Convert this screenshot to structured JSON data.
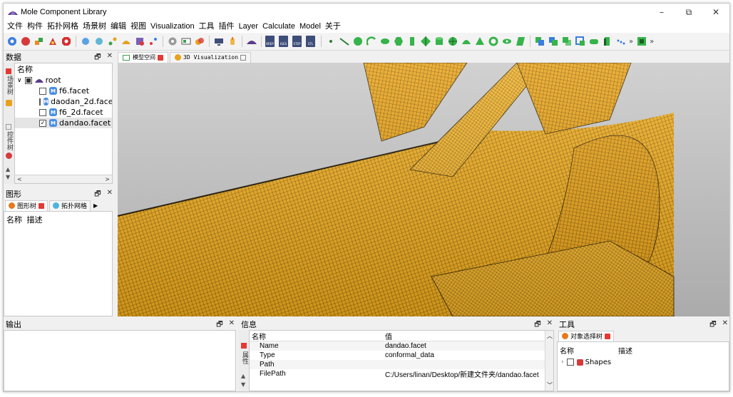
{
  "window": {
    "title": "Mole Component Library",
    "controls": {
      "minimize": "–",
      "restore": "⧉",
      "close": "✕"
    }
  },
  "menu": [
    "文件",
    "构件",
    "拓扑网格",
    "场景树",
    "编辑",
    "视图",
    "Visualization",
    "工具",
    "插件",
    "Layer",
    "Calculate",
    "Model",
    "关于"
  ],
  "toolbar": {
    "file_buttons": [
      "BREP",
      "IGES",
      "STEP",
      "STL"
    ],
    "more": "»"
  },
  "data_panel": {
    "title": "数据",
    "vtabs": [
      "场景树",
      "控件树"
    ],
    "tree_header": "名称",
    "root": "root",
    "items": [
      {
        "label": "f6.facet",
        "checked": false
      },
      {
        "label": "daodan_2d.facet",
        "checked": false
      },
      {
        "label": "f6_2d.facet",
        "checked": false
      },
      {
        "label": "dandao.facet",
        "checked": true
      }
    ],
    "scroll_left": "<",
    "scroll_right": ">"
  },
  "shape_panel": {
    "title": "图形",
    "tabs": [
      "图形树",
      "拓扑网格"
    ],
    "columns": [
      "名称",
      "描述"
    ]
  },
  "viewport": {
    "tabs": [
      "模型空间",
      "3D Visualization"
    ],
    "mesh_color": "#f0ac1e",
    "background": "#c9c9c9"
  },
  "output_panel": {
    "title": "输出"
  },
  "info_panel": {
    "title": "信息",
    "vtab": "属性",
    "columns": [
      "名称",
      "值"
    ],
    "rows": [
      {
        "name": "Name",
        "value": "dandao.facet"
      },
      {
        "name": "Type",
        "value": "conformal_data"
      },
      {
        "name": "Path",
        "value": ""
      },
      {
        "name": "FilePath",
        "value": "C:/Users/linan/Desktop/新建文件夹/dandao.facet"
      }
    ]
  },
  "tool_panel": {
    "title": "工具",
    "tab": "对象选择树",
    "columns": [
      "名称",
      "描述"
    ],
    "item": "Shapes"
  },
  "panel_controls": {
    "float": "🗗",
    "close": "✕"
  }
}
